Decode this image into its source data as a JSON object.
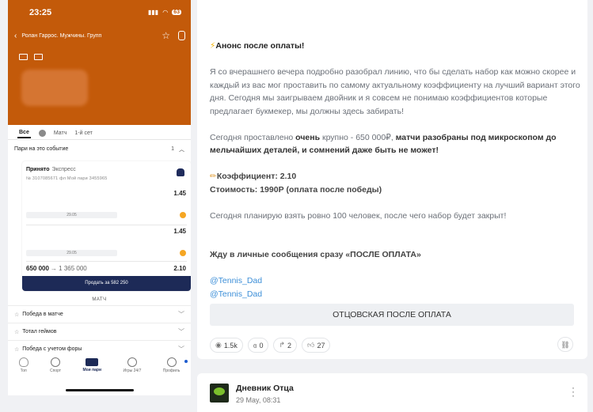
{
  "phone": {
    "status": {
      "time": "23:25",
      "battery": "63"
    },
    "nav": {
      "title": "Ролан Гаррос. Мужчины. Групп"
    },
    "tabs": [
      "Все",
      "Матч",
      "1-й сет"
    ],
    "section": {
      "title": "Пари на это событие",
      "count": "1"
    },
    "bet": {
      "status": "Принято",
      "type": "Экспресс",
      "number": "№ 3107085671 фл Мой пари 3455965",
      "legs": [
        {
          "odd": "1.45",
          "date": "29.05"
        },
        {
          "odd": "1.45",
          "date": "29.05"
        }
      ],
      "amount": "650 000",
      "win": "→ 1 365 000",
      "total_odd": "2.10",
      "sell_label": "Продать за 582 250"
    },
    "match_label": "МАТЧ",
    "markets": [
      "Победа в матче",
      "Тотал геймов",
      "Победа с учетом форы"
    ],
    "bottom_nav": [
      "Топ",
      "Спорт",
      "Мои пари",
      "Игры 24/7",
      "Профиль"
    ]
  },
  "post": {
    "title": "Анонс после оплаты!",
    "para1": "Я со вчерашнего вечера подробно разобрал линию, что бы сделать набор как можно скорее и каждый из вас мог проставить по самому актуальному коэффициенту на лучший вариант этого дня. Сегодня мы заигрываем двойник и я совсем не понимаю коэффициентов которые предлагает букмекер, мы должны здесь забирать!",
    "para2_a": "Сегодня проставлено ",
    "para2_b": "очень",
    "para2_c": " крупно - 650 000₽, ",
    "para2_d": "матчи разобраны под микроскопом до мельчайших деталей, и сомнений даже быть не может!",
    "coef": "Коэффициент: 2.10",
    "price": "Стоимость: 1990Р (оплата после победы)",
    "para3": "Сегодня планирую взять ровно 100 человек, после чего набор будет закрыт!",
    "para4": "Жду в личные сообщения сразу «ПОСЛЕ ОПЛАТА»",
    "link1": "@Tennis_Dad",
    "link2": "@Tennis_Dad",
    "button": "ОТЦОВСКАЯ ПОСЛЕ ОПЛАТА",
    "reactions": {
      "views": "1.5k",
      "comments": "0",
      "shares": "2",
      "likes": "27"
    }
  },
  "next_post": {
    "name": "Дневник Отца",
    "date": "29 May, 08:31"
  }
}
